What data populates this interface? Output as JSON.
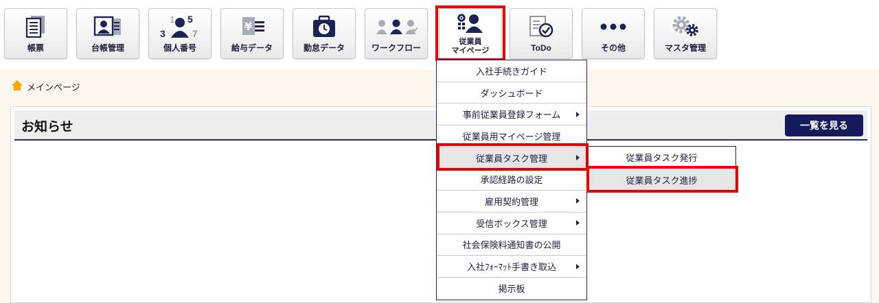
{
  "toolbar": {
    "buttons": [
      {
        "label": "帳票",
        "icon": "document-list-icon"
      },
      {
        "label": "台帳管理",
        "icon": "id-card-icon"
      },
      {
        "label": "個人番号",
        "icon": "person-number-icon",
        "digits": [
          "1",
          "5",
          "3",
          "7"
        ]
      },
      {
        "label": "給与データ",
        "icon": "salary-icon",
        "currency": "¥"
      },
      {
        "label": "勤怠データ",
        "icon": "clock-bag-icon"
      },
      {
        "label": "ワークフロー",
        "icon": "workflow-people-icon"
      },
      {
        "label_line1": "従業員",
        "label_line2": "マイページ",
        "icon": "employee-gear-icon"
      },
      {
        "label": "ToDo",
        "icon": "todo-check-icon"
      },
      {
        "label": "その他",
        "icon": "more-dots-icon"
      },
      {
        "label": "マスタ管理",
        "icon": "gears-icon"
      }
    ]
  },
  "breadcrumb": {
    "home_label": "メインページ",
    "icon": "home-icon"
  },
  "notice": {
    "title": "お知らせ",
    "view_all_label": "一覧を見る"
  },
  "menu": {
    "items": [
      {
        "label": "入社手続きガイド",
        "has_submenu": false
      },
      {
        "label": "ダッシュボード",
        "has_submenu": false
      },
      {
        "label": "事前従業員登録フォーム",
        "has_submenu": true
      },
      {
        "label": "従業員用マイページ管理",
        "has_submenu": false
      },
      {
        "label": "従業員タスク管理",
        "has_submenu": true,
        "active": true
      },
      {
        "label": "承認経路の設定",
        "has_submenu": false
      },
      {
        "label": "雇用契約管理",
        "has_submenu": true
      },
      {
        "label": "受信ボックス管理",
        "has_submenu": true
      },
      {
        "label": "社会保険料通知書の公開",
        "has_submenu": false
      },
      {
        "label": "入社ﾌｫｰﾏｯﾄ手書き取込",
        "has_submenu": true
      },
      {
        "label": "掲示板",
        "has_submenu": false
      }
    ]
  },
  "submenu": {
    "items": [
      {
        "label": "従業員タスク発行"
      },
      {
        "label": "従業員タスク進捗",
        "active": true
      }
    ]
  },
  "colors": {
    "highlight": "#e60000",
    "navy": "#141a5c",
    "breadcrumb_bg": "#fdf6ec"
  }
}
